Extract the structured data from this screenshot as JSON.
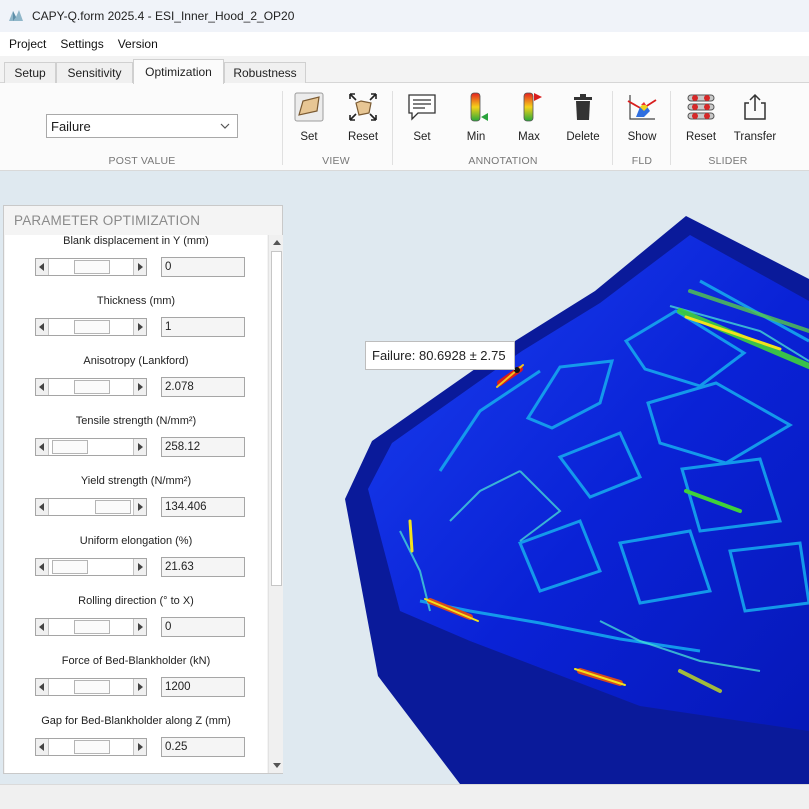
{
  "window": {
    "title": "CAPY-Q.form 2025.4 - ESI_Inner_Hood_2_OP20"
  },
  "menu": [
    "Project",
    "Settings",
    "Version"
  ],
  "tabs": [
    {
      "label": "Setup",
      "active": false
    },
    {
      "label": "Sensitivity",
      "active": false
    },
    {
      "label": "Optimization",
      "active": true
    },
    {
      "label": "Robustness",
      "active": false
    }
  ],
  "ribbon": {
    "post_value": {
      "selected": "Failure",
      "group_label": "POST VALUE"
    },
    "view": {
      "group_label": "VIEW",
      "set_label": "Set",
      "reset_label": "Reset"
    },
    "annotation": {
      "group_label": "ANNOTATION",
      "set_label": "Set",
      "min_label": "Min",
      "max_label": "Max",
      "delete_label": "Delete"
    },
    "fld": {
      "group_label": "FLD",
      "show_label": "Show"
    },
    "slider": {
      "group_label": "SLIDER",
      "reset_label": "Reset",
      "transfer_label": "Transfer"
    }
  },
  "viewport": {
    "annotation_text": "Failure: 80.6928 ± 2.75"
  },
  "panel": {
    "title": "PARAMETER OPTIMIZATION",
    "params": [
      {
        "label": "Blank displacement in Y (mm)",
        "value": "0",
        "position": 0.5
      },
      {
        "label": "Thickness (mm)",
        "value": "1",
        "position": 0.5
      },
      {
        "label": "Anisotropy (Lankford)",
        "value": "2.078",
        "position": 0.5
      },
      {
        "label": "Tensile strength (N/mm²)",
        "value": "258.12",
        "position": 0.05
      },
      {
        "label": "Yield strength (N/mm²)",
        "value": "134.406",
        "position": 0.93
      },
      {
        "label": "Uniform elongation (%)",
        "value": "21.63",
        "position": 0.05
      },
      {
        "label": "Rolling direction (° to X)",
        "value": "0",
        "position": 0.5
      },
      {
        "label": "Force of Bed-Blankholder (kN)",
        "value": "1200",
        "position": 0.5
      },
      {
        "label": "Gap for Bed-Blankholder along Z (mm)",
        "value": "0.25",
        "position": 0.5
      }
    ]
  },
  "colors": {
    "failure_high": "#d81d1d",
    "failure_mid": "#f2e21b",
    "failure_low": "#0d1fd8",
    "viewport_bg": "#dfe9f0"
  }
}
